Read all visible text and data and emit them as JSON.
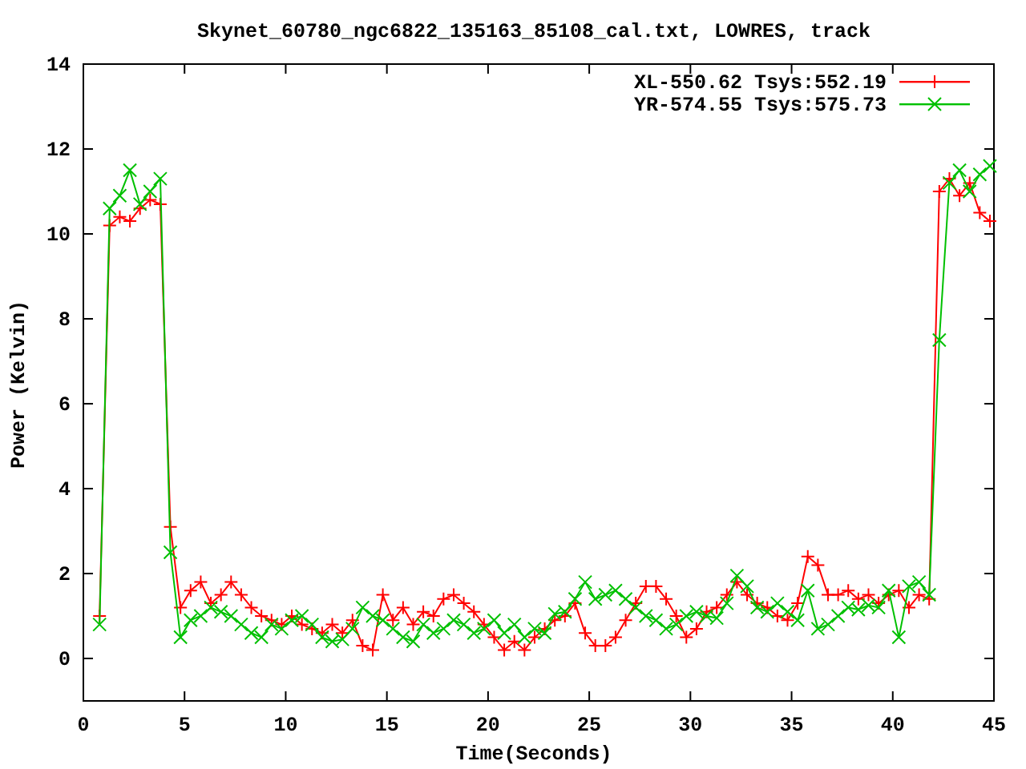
{
  "chart": {
    "chart_data": {
      "type": "line",
      "title": "Skynet_60780_ngc6822_135163_85108_cal.txt, LOWRES, track",
      "xlabel": "Time(Seconds)",
      "ylabel": "Power (Kelvin)",
      "xlim": [
        0,
        45
      ],
      "ylim": [
        -1,
        14
      ],
      "legend": "top-right",
      "xticks": [
        0,
        5,
        10,
        15,
        20,
        25,
        30,
        35,
        40,
        45
      ],
      "yticks": [
        0,
        2,
        4,
        6,
        8,
        10,
        12,
        14
      ],
      "x": [
        0.8,
        1.3,
        1.8,
        2.3,
        2.8,
        3.3,
        3.8,
        4.3,
        4.8,
        5.3,
        5.8,
        6.3,
        6.8,
        7.3,
        7.8,
        8.3,
        8.8,
        9.3,
        9.8,
        10.3,
        10.8,
        11.3,
        11.8,
        12.3,
        12.8,
        13.3,
        13.8,
        14.3,
        14.8,
        15.3,
        15.8,
        16.3,
        16.8,
        17.3,
        17.8,
        18.3,
        18.8,
        19.3,
        19.8,
        20.3,
        20.8,
        21.3,
        21.8,
        22.3,
        22.8,
        23.3,
        23.8,
        24.3,
        24.8,
        25.3,
        25.8,
        26.3,
        26.8,
        27.3,
        27.8,
        28.3,
        28.8,
        29.3,
        29.8,
        30.3,
        30.8,
        31.3,
        31.8,
        32.3,
        32.8,
        33.3,
        33.8,
        34.3,
        34.8,
        35.3,
        35.8,
        36.3,
        36.8,
        37.3,
        37.8,
        38.3,
        38.8,
        39.3,
        39.8,
        40.3,
        40.8,
        41.3,
        41.8,
        42.3,
        42.8,
        43.3,
        43.8,
        44.3,
        44.8
      ],
      "series": [
        {
          "name": "XL-550.62 Tsys:552.19",
          "color": "#ff0000",
          "marker": "plus",
          "values": [
            1.0,
            10.2,
            10.4,
            10.3,
            10.6,
            10.8,
            10.7,
            3.1,
            1.2,
            1.6,
            1.8,
            1.3,
            1.5,
            1.8,
            1.5,
            1.2,
            1.0,
            0.9,
            0.8,
            1.0,
            0.8,
            0.7,
            0.6,
            0.8,
            0.6,
            0.9,
            0.3,
            0.2,
            1.5,
            0.9,
            1.2,
            0.8,
            1.1,
            1.0,
            1.4,
            1.5,
            1.3,
            1.1,
            0.8,
            0.5,
            0.2,
            0.4,
            0.2,
            0.5,
            0.7,
            0.9,
            1.0,
            1.3,
            0.6,
            0.3,
            0.3,
            0.5,
            0.9,
            1.3,
            1.7,
            1.7,
            1.4,
            1.0,
            0.5,
            0.7,
            1.1,
            1.2,
            1.5,
            1.8,
            1.5,
            1.3,
            1.2,
            1.0,
            0.9,
            1.3,
            2.4,
            2.2,
            1.5,
            1.5,
            1.6,
            1.4,
            1.5,
            1.3,
            1.5,
            1.6,
            1.2,
            1.5,
            1.4,
            11.0,
            11.3,
            10.9,
            11.2,
            10.5,
            10.3
          ]
        },
        {
          "name": "YR-574.55 Tsys:575.73",
          "color": "#00c000",
          "marker": "cross",
          "values": [
            0.8,
            10.6,
            10.9,
            11.5,
            10.7,
            11.0,
            11.3,
            2.5,
            0.5,
            0.9,
            1.0,
            1.2,
            1.1,
            1.0,
            0.8,
            0.6,
            0.5,
            0.8,
            0.7,
            0.9,
            1.0,
            0.8,
            0.5,
            0.4,
            0.45,
            0.7,
            1.2,
            1.0,
            0.9,
            0.7,
            0.5,
            0.4,
            0.8,
            0.6,
            0.7,
            0.9,
            0.8,
            0.6,
            0.7,
            0.9,
            0.6,
            0.8,
            0.5,
            0.7,
            0.6,
            1.05,
            1.1,
            1.4,
            1.8,
            1.4,
            1.5,
            1.6,
            1.4,
            1.2,
            1.0,
            0.9,
            0.7,
            0.8,
            1.0,
            1.1,
            1.0,
            0.95,
            1.3,
            1.95,
            1.7,
            1.2,
            1.1,
            1.3,
            1.1,
            0.9,
            1.6,
            0.7,
            0.8,
            1.0,
            1.2,
            1.15,
            1.25,
            1.2,
            1.6,
            0.5,
            1.7,
            1.8,
            1.5,
            7.5,
            11.2,
            11.5,
            11.0,
            11.4,
            11.6
          ]
        }
      ]
    }
  }
}
